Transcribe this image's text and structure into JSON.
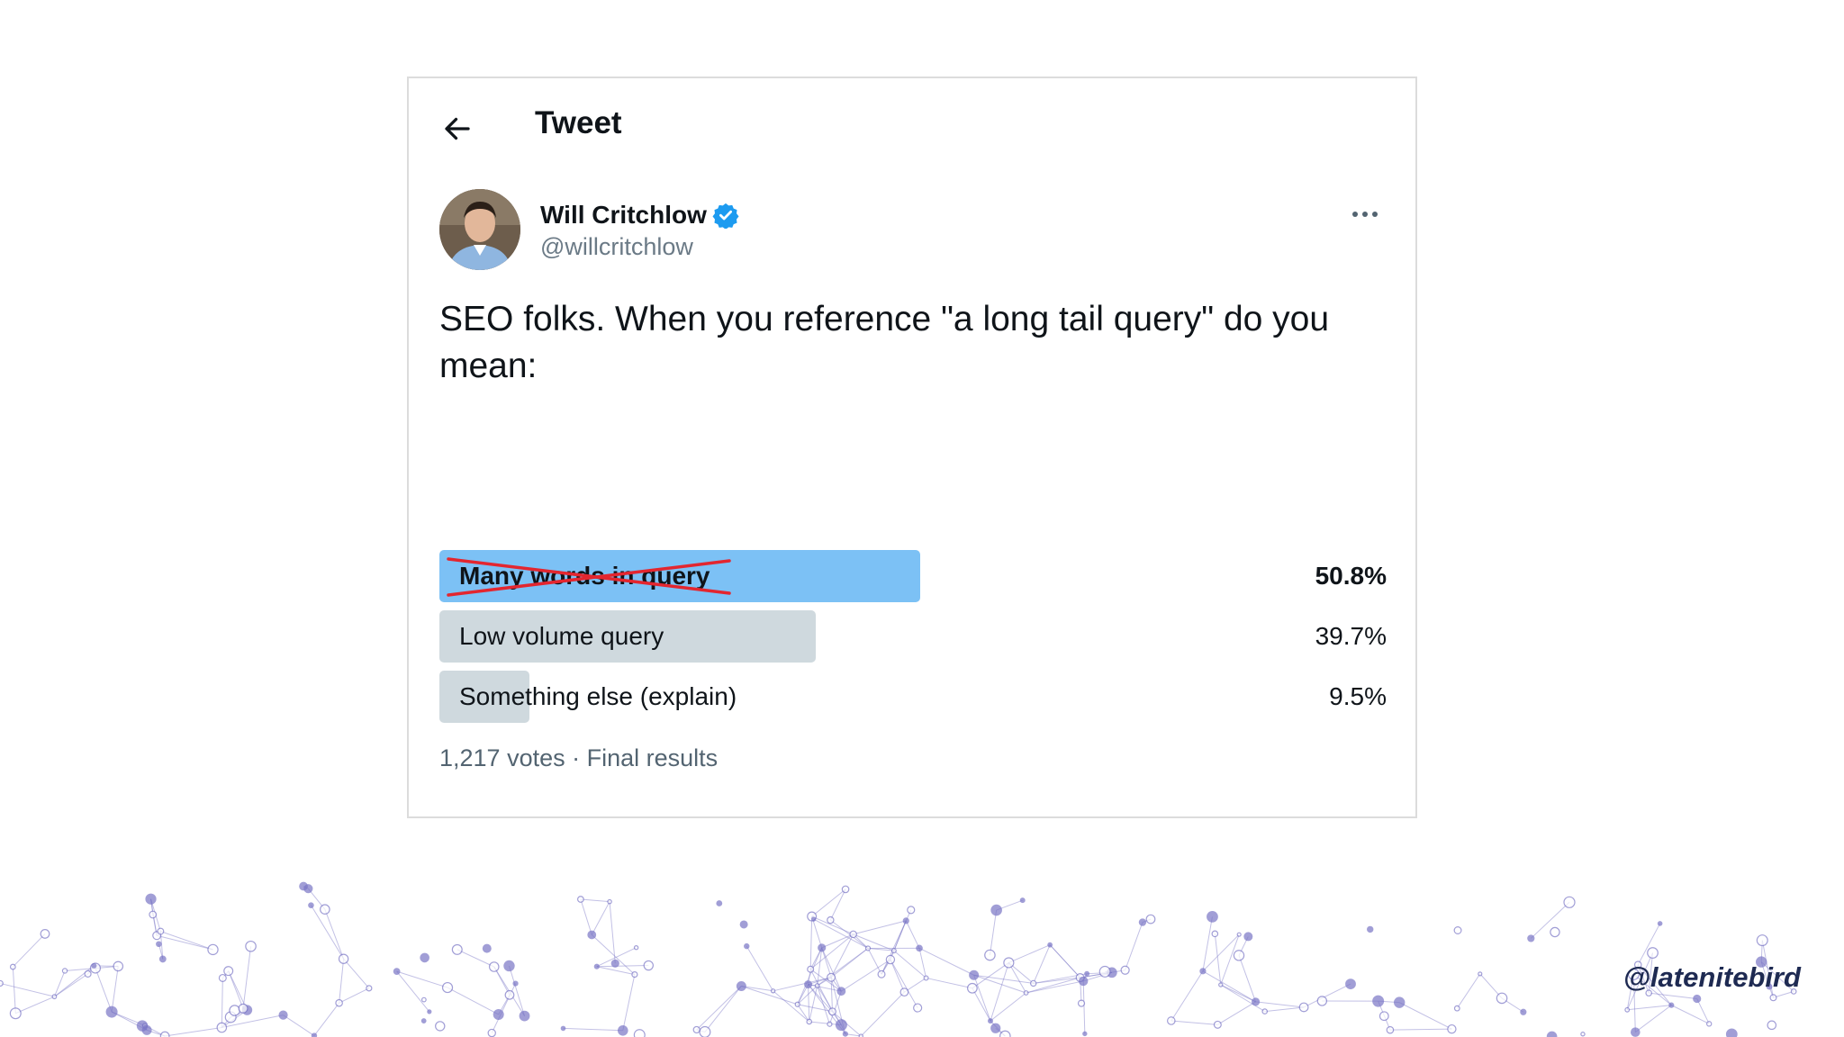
{
  "header": {
    "title": "Tweet"
  },
  "author": {
    "name": "Will Critchlow",
    "handle": "@willcritchlow",
    "verified": true
  },
  "tweet": {
    "text": "SEO folks. When you reference \"a long tail query\" do you mean:"
  },
  "poll": {
    "options": [
      {
        "label": "Many words in query",
        "percent": "50.8%",
        "fraction": 0.508,
        "winner": true,
        "crossed_out": true
      },
      {
        "label": "Low volume query",
        "percent": "39.7%",
        "fraction": 0.397,
        "winner": false,
        "crossed_out": false
      },
      {
        "label": "Something else (explain)",
        "percent": "9.5%",
        "fraction": 0.095,
        "winner": false,
        "crossed_out": false
      }
    ],
    "footer": "1,217 votes · Final results"
  },
  "branding": {
    "handle": "@latenitebird"
  },
  "colors": {
    "winner_bar": "#7cc1f5",
    "other_bar": "#cfd9de",
    "strike": "#e3262f",
    "verified": "#1d9bf0",
    "brand": "#1e2a52",
    "network": "#7a76c6"
  },
  "icons": {
    "back": "arrow-left-icon",
    "verified": "verified-badge-icon",
    "more": "more-horizontal-icon"
  }
}
